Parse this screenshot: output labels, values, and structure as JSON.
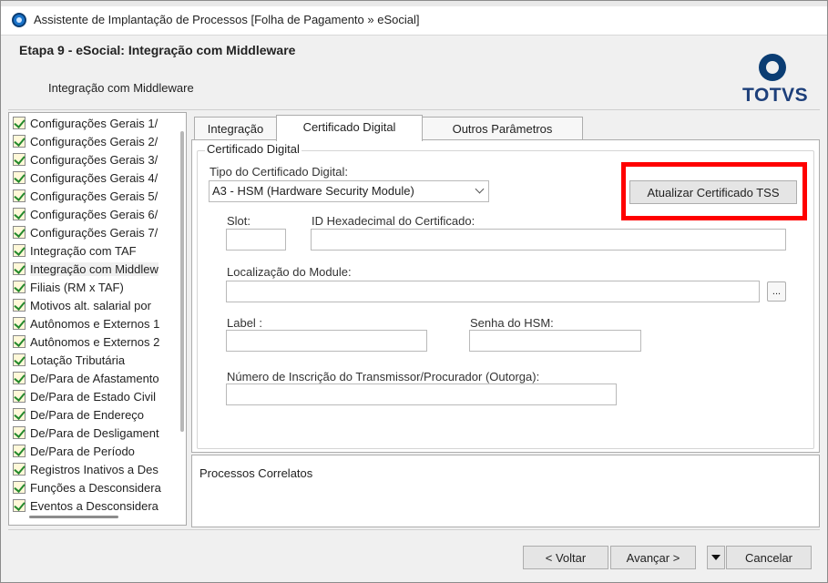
{
  "window": {
    "title": "Assistente de Implantação de Processos [Folha de Pagamento » eSocial]"
  },
  "header": {
    "step_title": "Etapa 9 - eSocial: Integração com Middleware",
    "subtitle": "Integração com Middleware",
    "logo_text": "TOTVS"
  },
  "sidebar": {
    "items": [
      {
        "label": "Configurações Gerais 1/"
      },
      {
        "label": "Configurações Gerais 2/"
      },
      {
        "label": "Configurações Gerais 3/"
      },
      {
        "label": "Configurações Gerais 4/"
      },
      {
        "label": "Configurações Gerais 5/"
      },
      {
        "label": "Configurações Gerais 6/"
      },
      {
        "label": "Configurações Gerais 7/"
      },
      {
        "label": "Integração com TAF"
      },
      {
        "label": "Integração com Middlew"
      },
      {
        "label": "Filiais (RM x TAF)"
      },
      {
        "label": "Motivos alt. salarial por"
      },
      {
        "label": "Autônomos e Externos 1"
      },
      {
        "label": "Autônomos e Externos 2"
      },
      {
        "label": "Lotação Tributária"
      },
      {
        "label": "De/Para de Afastamento"
      },
      {
        "label": "De/Para de Estado Civil"
      },
      {
        "label": "De/Para de Endereço"
      },
      {
        "label": "De/Para de Desligament"
      },
      {
        "label": "De/Para de Período"
      },
      {
        "label": "Registros Inativos a Des"
      },
      {
        "label": "Funções a Desconsidera"
      },
      {
        "label": "Eventos a Desconsidera"
      }
    ],
    "selected_index": 8
  },
  "tabs": [
    {
      "label": "Integração"
    },
    {
      "label": "Certificado Digital"
    },
    {
      "label": "Outros Parâmetros"
    }
  ],
  "active_tab": 1,
  "form": {
    "group_title": "Certificado Digital",
    "cert_type_label": "Tipo do Certificado Digital:",
    "cert_type_value": "A3 - HSM (Hardware Security Module)",
    "update_button": "Atualizar Certificado TSS",
    "slot_label": "Slot:",
    "slot_value": "",
    "hex_id_label": "ID Hexadecimal do Certificado:",
    "hex_id_value": "",
    "module_label": "Localização do Module:",
    "module_value": "",
    "browse_button": "...",
    "label_label": "Label :",
    "label_value": "",
    "hsm_password_label": "Senha do HSM:",
    "hsm_password_value": "",
    "inscription_label": "Número de Inscrição do Transmissor/Procurador (Outorga):",
    "inscription_value": "",
    "highlight_color": "#ff0000"
  },
  "correlatos": {
    "label": "Processos Correlatos"
  },
  "footer": {
    "back": "< Voltar",
    "next": "Avançar >",
    "cancel": "Cancelar"
  }
}
